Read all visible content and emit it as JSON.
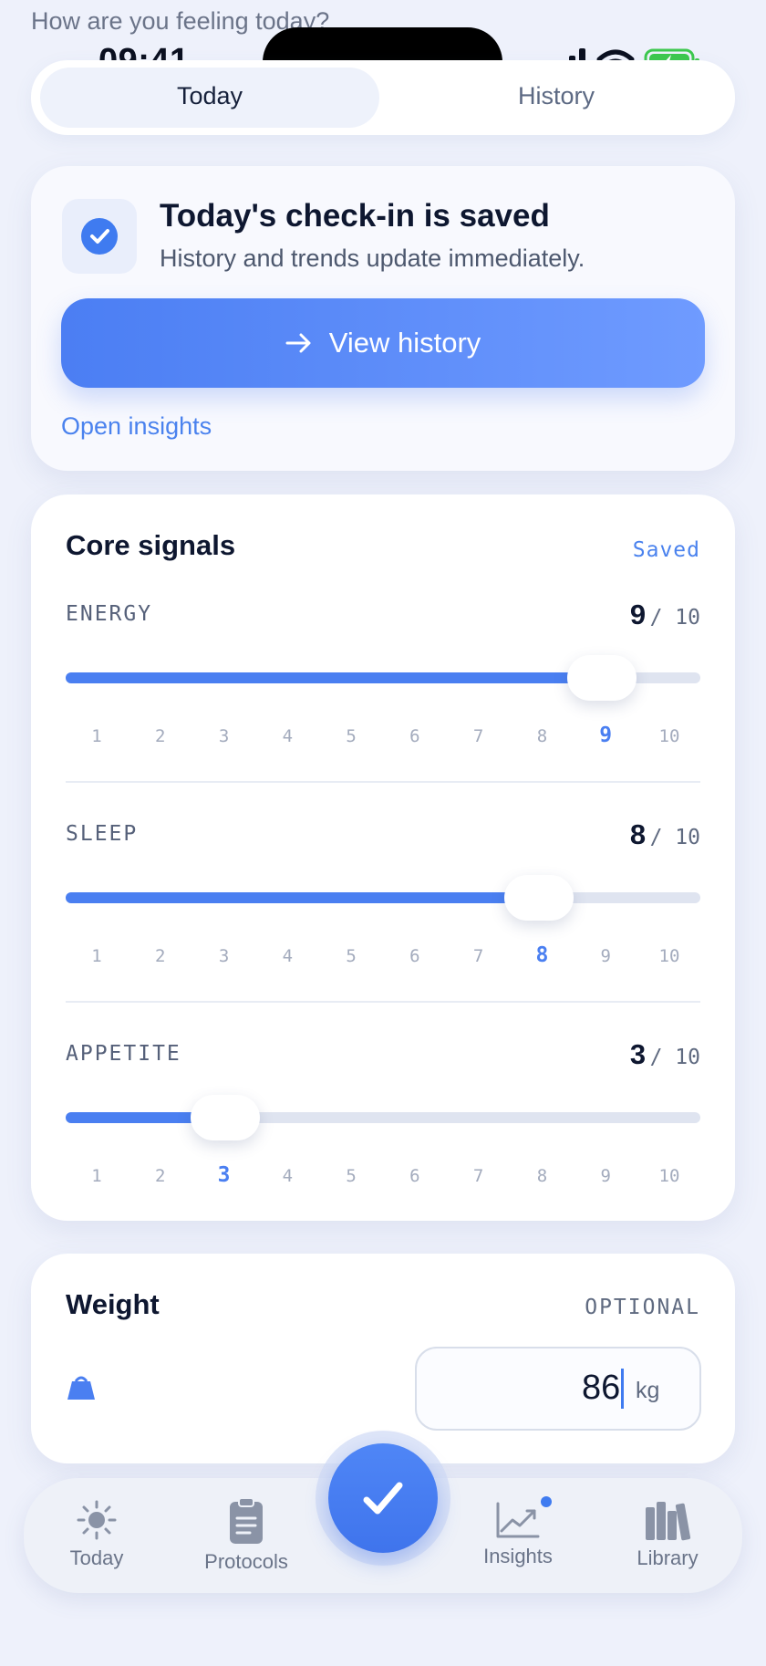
{
  "prompt": "How are you feeling today?",
  "status_bar": {
    "time": "09:41"
  },
  "segmented": {
    "today": "Today",
    "history": "History",
    "selected": "Today"
  },
  "saved_card": {
    "title": "Today's check-in is saved",
    "subtitle": "History and trends update immediately.",
    "button_label": "View history",
    "link_label": "Open insights"
  },
  "core": {
    "title": "Core signals",
    "badge": "Saved",
    "max_label": "/ 10",
    "scale": [
      "1",
      "2",
      "3",
      "4",
      "5",
      "6",
      "7",
      "8",
      "9",
      "10"
    ],
    "metrics": [
      {
        "label": "ENERGY",
        "value": "9"
      },
      {
        "label": "SLEEP",
        "value": "8"
      },
      {
        "label": "APPETITE",
        "value": "3"
      }
    ]
  },
  "weight": {
    "title": "Weight",
    "badge": "OPTIONAL",
    "value": "86",
    "unit": "kg"
  },
  "tabbar": {
    "today": "Today",
    "protocols": "Protocols",
    "insights": "Insights",
    "library": "Library"
  },
  "colors": {
    "accent": "#4a7ff1",
    "background": "#eef1fb",
    "text": "#0e1730"
  }
}
